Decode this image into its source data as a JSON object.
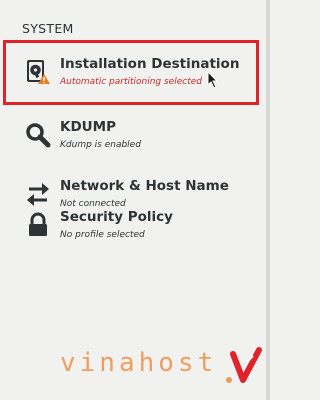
{
  "section": {
    "heading": "SYSTEM"
  },
  "spokes": [
    {
      "title": "Installation Destination",
      "status": "Automatic partitioning selected",
      "icon": "disk-warning-icon",
      "status_color": "#cc2929"
    },
    {
      "title": "KDUMP",
      "status": "Kdump is enabled",
      "icon": "magnifier-icon"
    },
    {
      "title": "Network & Host Name",
      "status": "Not connected",
      "icon": "network-arrows-icon"
    },
    {
      "title": "Security Policy",
      "status": "No profile selected",
      "icon": "lock-icon"
    }
  ],
  "watermark": {
    "text": "vinahost",
    "color": "#f08a3c"
  },
  "highlight_color": "#e0222b"
}
